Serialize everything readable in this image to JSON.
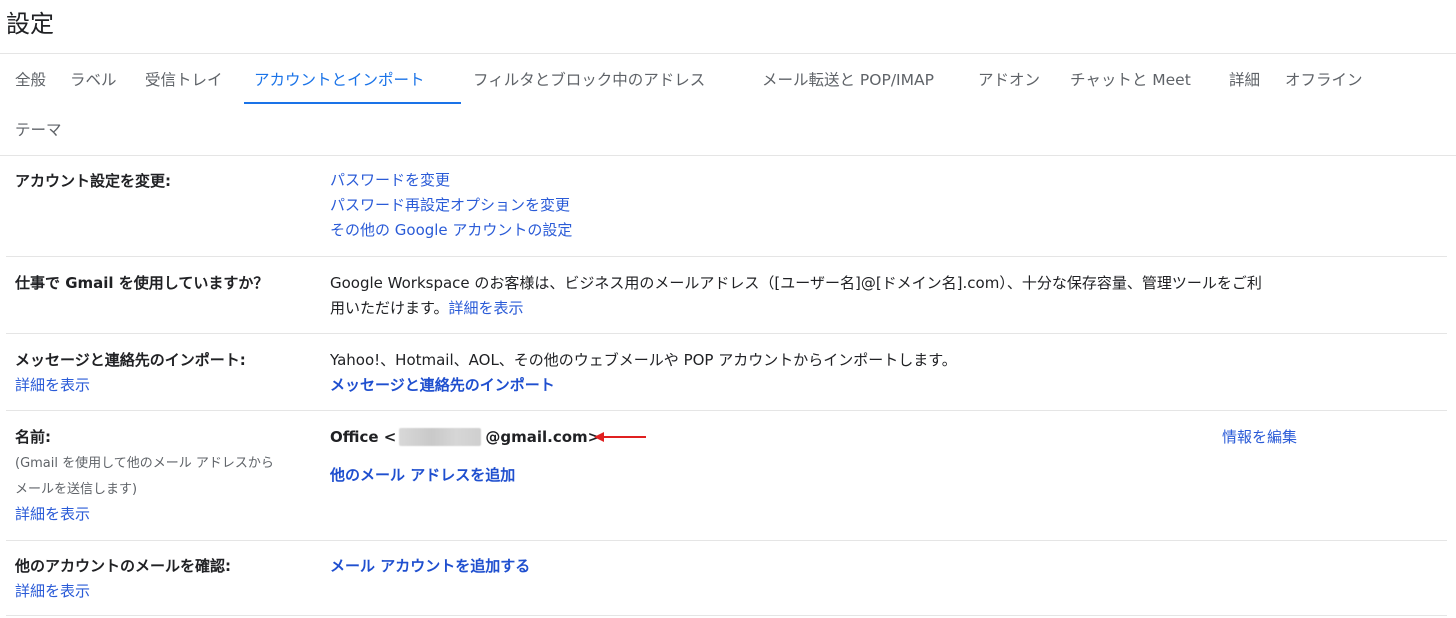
{
  "header": {
    "title": "設定"
  },
  "tabs": [
    {
      "label": "全般",
      "active": false
    },
    {
      "label": "ラベル",
      "active": false
    },
    {
      "label": "受信トレイ",
      "active": false
    },
    {
      "label": "アカウントとインポート",
      "active": true
    },
    {
      "label": "フィルタとブロック中のアドレス",
      "active": false
    },
    {
      "label": "メール転送と POP/IMAP",
      "active": false
    },
    {
      "label": "アドオン",
      "active": false
    },
    {
      "label": "チャットと Meet",
      "active": false
    },
    {
      "label": "詳細",
      "active": false
    },
    {
      "label": "オフライン",
      "active": false
    },
    {
      "label": "テーマ",
      "active": false
    }
  ],
  "account_settings": {
    "label": "アカウント設定を変更:",
    "links": [
      "パスワードを変更",
      "パスワード再設定オプションを変更",
      "その他の Google アカウントの設定"
    ]
  },
  "workspace": {
    "label": "仕事で Gmail を使用していますか？",
    "line1": "Google Workspace のお客様は、ビジネス用のメールアドレス（[ユーザー名]@[ドメイン名].com）、十分な保存容量、管理ツールをご利",
    "line2": "用いただけます。",
    "link": "詳細を表示"
  },
  "import": {
    "label": "メッセージと連絡先のインポート:",
    "sub_link": "詳細を表示",
    "description": "Yahoo!、Hotmail、AOL、その他のウェブメールや POP アカウントからインポートします。",
    "action": "メッセージと連絡先のインポート"
  },
  "name": {
    "label": "名前:",
    "sub_line1": "(Gmail を使用して他のメール アドレスから",
    "sub_line2": "メールを送信します)",
    "sub_link": "詳細を表示",
    "prefix": "Office <",
    "suffix": "@gmail.com>",
    "add_address": "他のメール アドレスを追加",
    "edit": "情報を編集"
  },
  "check_mail": {
    "label": "他のアカウントのメールを確認:",
    "sub_link": "詳細を表示",
    "action": "メール アカウントを追加する"
  },
  "colors": {
    "link": "#2a5bd7",
    "active_tab": "#1a73e8",
    "arrow": "#e02020"
  }
}
